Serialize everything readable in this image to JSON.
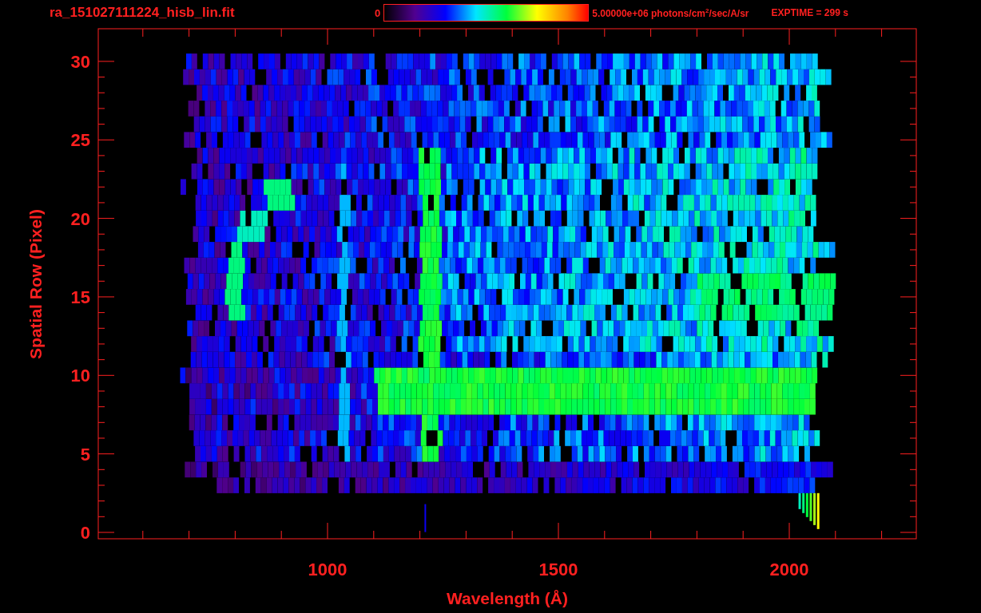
{
  "title": "ra_151027111224_hisb_lin.fit",
  "colorbar": {
    "min_label": "0",
    "max_label": "5.00000e+06 photons/cm$^{2}$/sec/A/sr"
  },
  "exposure": "EXPTIME = 299 s",
  "plot": {
    "xlabel": "Wavelength (Å)",
    "ylabel": "Spatial Row (Pixel)",
    "xticks": [
      "1000",
      "1500",
      "2000"
    ],
    "yticks": [
      "30",
      "25",
      "20",
      "15",
      "10",
      "5",
      "0"
    ]
  }
}
